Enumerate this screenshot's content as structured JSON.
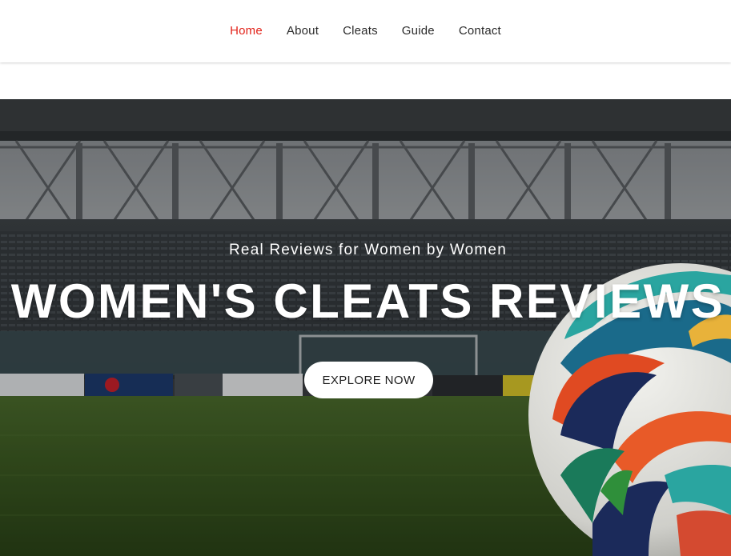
{
  "nav": {
    "items": [
      {
        "label": "Home",
        "active": true
      },
      {
        "label": "About",
        "active": false
      },
      {
        "label": "Cleats",
        "active": false
      },
      {
        "label": "Guide",
        "active": false
      },
      {
        "label": "Contact",
        "active": false
      }
    ],
    "active_color": "#e2231a"
  },
  "hero": {
    "subtitle": "Real Reviews for Women by Women",
    "title": "WOMEN'S CLEATS REVIEWS",
    "button_label": "EXPLORE NOW",
    "image_subject": "soccer stadium with soccer ball on grass"
  }
}
